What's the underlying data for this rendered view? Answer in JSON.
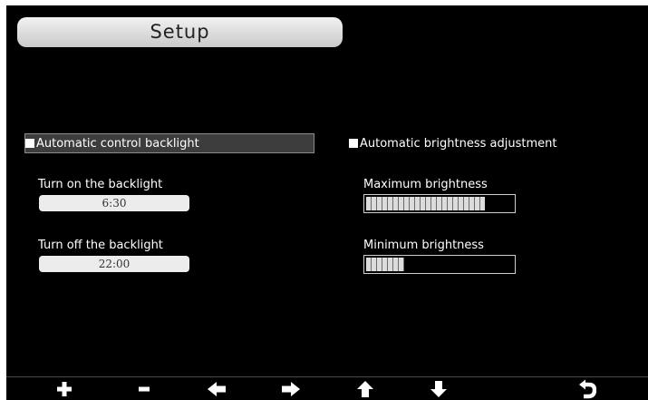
{
  "title": "Setup",
  "left_panel": {
    "auto_backlight_label": "Automatic control backlight",
    "turn_on_label": "Turn on the backlight",
    "turn_on_value": "6:30",
    "turn_off_label": "Turn off the backlight",
    "turn_off_value": "22:00"
  },
  "right_panel": {
    "auto_brightness_label": "Automatic brightness adjustment",
    "max_brightness_label": "Maximum brightness",
    "max_brightness_level": 0.81,
    "min_brightness_label": "Minimum brightness",
    "min_brightness_level": 0.26
  },
  "toolbar": {
    "buttons": [
      {
        "icon": "plus-icon"
      },
      {
        "icon": "minus-icon"
      },
      {
        "icon": "arrow-left-icon"
      },
      {
        "icon": "arrow-right-icon"
      },
      {
        "icon": "arrow-up-icon"
      },
      {
        "icon": "arrow-down-icon"
      },
      {
        "icon": "back-icon"
      }
    ]
  },
  "colors": {
    "background": "#000000",
    "text": "#ffffff",
    "field": "#ececec"
  }
}
